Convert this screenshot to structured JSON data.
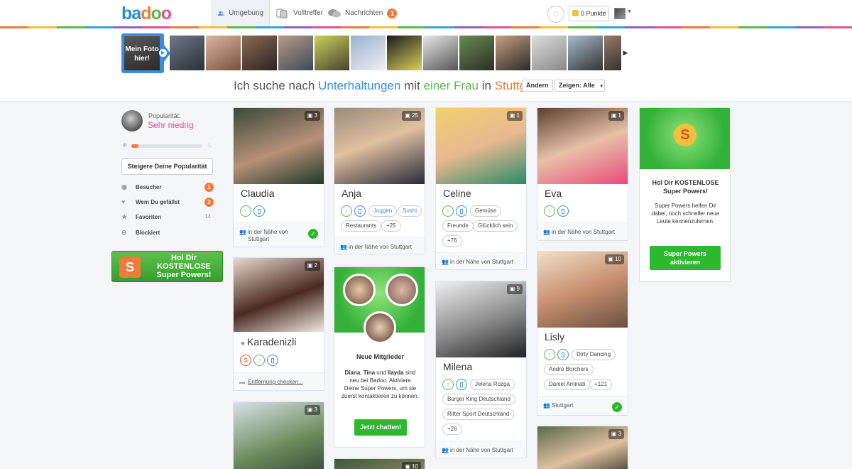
{
  "header": {
    "logo": {
      "p1": "ba",
      "p2": "d",
      "p3": "o",
      "p4": "o"
    },
    "nav": [
      {
        "label": "Umgebung",
        "active": true
      },
      {
        "label": "Volltreffer"
      },
      {
        "label": "Nachrichten",
        "badge": "1"
      }
    ],
    "points_label": "0 Punkte"
  },
  "strip": {
    "my_photo_label": "Mein Foto hier!"
  },
  "search": {
    "prefix": "Ich suche nach",
    "looking_for": "Unterhaltungen",
    "with": "mit",
    "gender": "einer Frau",
    "in": "in",
    "location": "Stuttgart",
    "change_button": "Ändern",
    "show_button": "Zeigen: Alle"
  },
  "sidebar": {
    "popularity_label": "Popularität:",
    "popularity_value": "Sehr niedrig",
    "popularity_level": 0.1,
    "boost_button": "Steigere Deine Popularität",
    "items": [
      {
        "label": "Besucher",
        "count": "1"
      },
      {
        "label": "Wem Du gefällst",
        "count": "3"
      },
      {
        "label": "Favoriten",
        "count": "14"
      },
      {
        "label": "Blockiert",
        "count": ""
      }
    ],
    "superpowers_banner": "Hol Dir KOSTENLOSE Super Powers!"
  },
  "cards": {
    "claudia": {
      "name": "Claudia",
      "photos": "3",
      "location": "in der Nähe von Stuttgart"
    },
    "karadenizli": {
      "name": "Karadenizli",
      "photos": "2",
      "distance": "Entfernung checken..."
    },
    "c3": {
      "photos": "3"
    },
    "anja": {
      "name": "Anja",
      "photos": "25",
      "interests": [
        "Joggen",
        "Sushi",
        "Restaurants",
        "+25"
      ],
      "location": "in der Nähe von Stuttgart"
    },
    "new_members": {
      "title": "Neue Mitglieder",
      "names": [
        "Diana",
        "Tina",
        "Ilayda"
      ],
      "sep1": ",",
      "sep2": "und",
      "text": "sind neu bei Badoo. Aktiviere Deine Super Powers, um sie zuerst kontaktieren zu können.",
      "button": "Jetzt chatten!"
    },
    "c6": {
      "photos": "10"
    },
    "celine": {
      "name": "Celine",
      "photos": "1",
      "interests": [
        "Gemüse",
        "Freunde",
        "Glücklich sein",
        "+76"
      ],
      "location": "in der Nähe von Stuttgart"
    },
    "milena": {
      "name": "Milena",
      "photos": "9",
      "interests": [
        "Jelena Rozga",
        "Burger King Deutschland",
        "Ritter Sport Deutschland",
        "+26"
      ],
      "location": "in der Nähe von Stuttgart"
    },
    "eva": {
      "name": "Eva",
      "photos": "1",
      "location": "in der Nähe von Stuttgart"
    },
    "lisly": {
      "name": "Lisly",
      "photos": "10",
      "interests": [
        "Dirty Dancing",
        "André Borchers",
        "Daniel Aminati",
        "+121"
      ],
      "location": "Stuttgart"
    },
    "c11": {
      "photos": "3"
    },
    "superpowers": {
      "title": "Hol Dir KOSTENLOSE Super Powers!",
      "text": "Super Powers helfen Dir dabei, noch schneller neue Leute kennenzulernen.",
      "button": "Super Powers aktivieren",
      "logo": "S"
    }
  },
  "icons": {
    "up": "↑",
    "phone": "▯",
    "check": "✓",
    "photo": "📷",
    "sp": "S"
  },
  "colors": {
    "accent_blue": "#3a8ee0",
    "orange": "#f07a3a",
    "green": "#5cb84d",
    "pink": "#e5508f",
    "button_green": "#2db92d"
  }
}
